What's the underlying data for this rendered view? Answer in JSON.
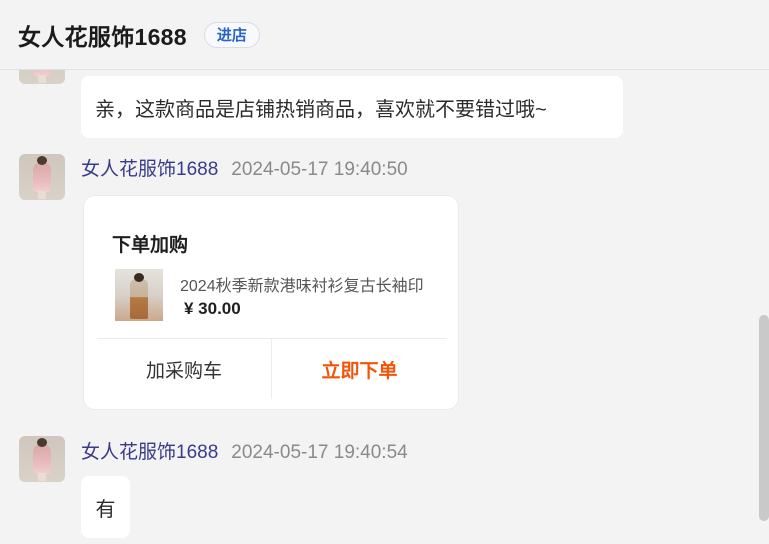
{
  "header": {
    "shop_name": "女人花服饰1688",
    "enter_shop_label": "进店"
  },
  "messages": [
    {
      "text": "亲，这款商品是店铺热销商品，喜欢就不要错过哦~"
    },
    {
      "sender": "女人花服饰1688",
      "time": "2024-05-17 19:40:50",
      "card": {
        "title": "下单加购",
        "product_name": "2024秋季新款港味衬衫复古长袖印",
        "price": "¥ 30.00",
        "add_cart_label": "加采购车",
        "buy_now_label": "立即下单"
      }
    },
    {
      "sender": "女人花服饰1688",
      "time": "2024-05-17 19:40:54",
      "text": "有"
    }
  ],
  "colors": {
    "background": "#f3f3f3",
    "sender_name": "#3a3a8c",
    "buy_now": "#f2540a",
    "enter_shop": "#2a64c4"
  }
}
